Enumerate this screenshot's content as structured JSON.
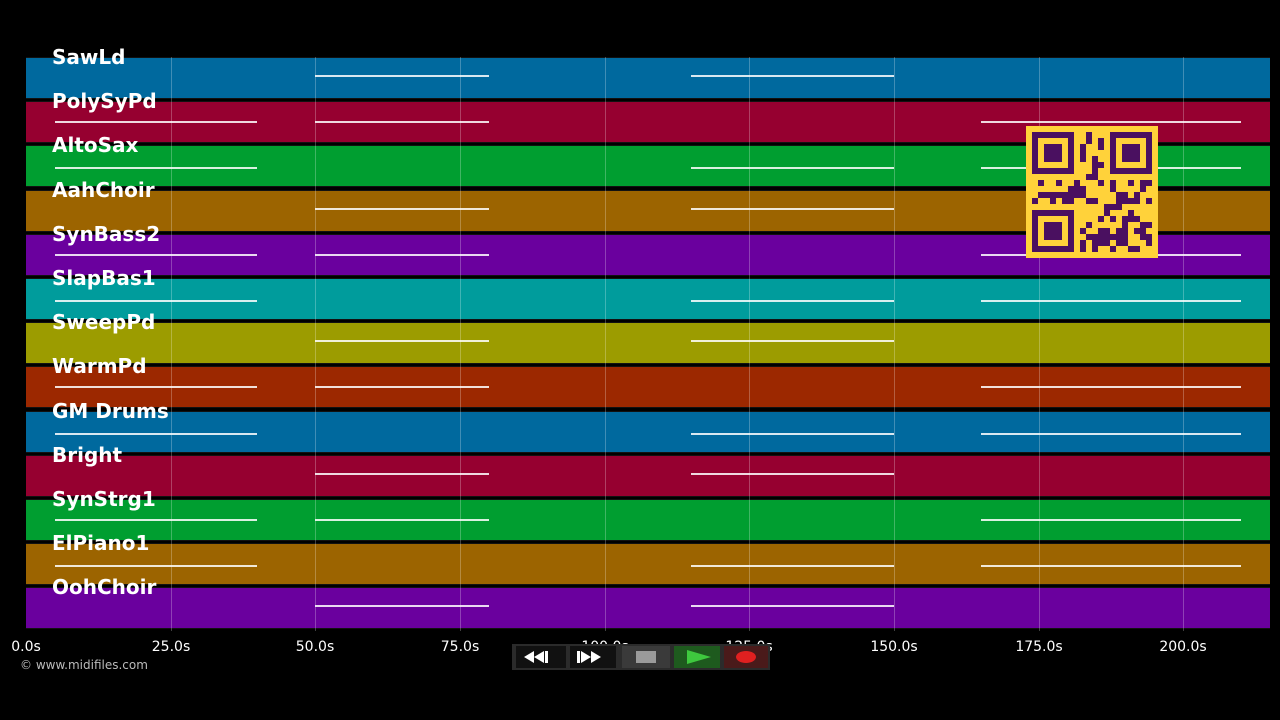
{
  "transport": {
    "rewind_icon": "rewind-icon",
    "forward_icon": "fast-forward-icon",
    "stop_icon": "stop-icon",
    "play_icon": "play-icon",
    "record_icon": "record-icon"
  },
  "copyright": "© www.midifiles.com",
  "tracks": [
    {
      "label": "SawLd",
      "color": "#00699e"
    },
    {
      "label": "PolySyPd",
      "color": "#960030"
    },
    {
      "label": "AltoSax",
      "color": "#009e30"
    },
    {
      "label": "AahChoir",
      "color": "#9c6400"
    },
    {
      "label": "SynBass2",
      "color": "#6a009e"
    },
    {
      "label": "SlapBas1",
      "color": "#009c9c"
    },
    {
      "label": "SweepPd",
      "color": "#9c9c00"
    },
    {
      "label": "WarmPd",
      "color": "#9c2800"
    },
    {
      "label": "GM Drums",
      "color": "#00699e"
    },
    {
      "label": "Bright",
      "color": "#960030"
    },
    {
      "label": "SynStrg1",
      "color": "#009e30"
    },
    {
      "label": "ElPiano1",
      "color": "#9c6400"
    },
    {
      "label": "OohChoir",
      "color": "#6a009e"
    }
  ],
  "timeline": {
    "ticks": [
      "0.0s",
      "25.0s",
      "50.0s",
      "75.0s",
      "100.0s",
      "125.0s",
      "150.0s",
      "175.0s",
      "200.0s"
    ],
    "tick_values": [
      0,
      25,
      50,
      75,
      100,
      125,
      150,
      175,
      200
    ],
    "max_seconds": 215
  },
  "qr_code": "qr-code"
}
